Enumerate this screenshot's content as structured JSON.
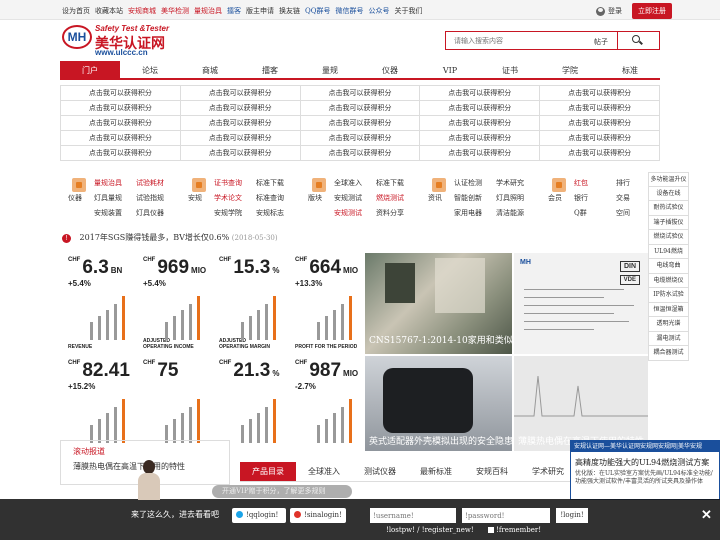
{
  "topbar": {
    "links": [
      {
        "text": "设为首页",
        "color": "normal"
      },
      {
        "text": "收藏本站",
        "color": "normal"
      },
      {
        "text": "安规商城",
        "color": "red"
      },
      {
        "text": "美华检测",
        "color": "red"
      },
      {
        "text": "量规治具",
        "color": "red"
      },
      {
        "text": "擂客",
        "color": "blue"
      },
      {
        "text": "版主申请",
        "color": "normal"
      },
      {
        "text": "换友链",
        "color": "normal"
      },
      {
        "text": "QQ群号",
        "color": "blue"
      },
      {
        "text": "微信群号",
        "color": "blue"
      },
      {
        "text": "公众号",
        "color": "blue"
      },
      {
        "text": "关于我们",
        "color": "normal"
      }
    ],
    "login": "登录",
    "register": "立即注册"
  },
  "logo": {
    "mark": "MH",
    "en": "Safety Test &Tester",
    "cn": "美华认证网",
    "url": "www.ulccc.cn"
  },
  "search": {
    "placeholder": "请输入搜索内容",
    "tag": "帖子"
  },
  "nav": [
    "门户",
    "论坛",
    "商城",
    "擂客",
    "量规",
    "仪器",
    "VIP",
    "证书",
    "学院",
    "标准"
  ],
  "grid": {
    "cell": "点击我可以获得积分",
    "rows": 5,
    "cols": 5
  },
  "categories": [
    {
      "name": "仪器",
      "links": [
        {
          "t": "量规治具",
          "r": true
        },
        {
          "t": "试验耗材",
          "r": true
        },
        {
          "t": "灯具量规",
          "r": false
        },
        {
          "t": "试验指规",
          "r": false
        },
        {
          "t": "安规装置",
          "r": false
        },
        {
          "t": "灯具仪器",
          "r": false
        }
      ]
    },
    {
      "name": "安规",
      "links": [
        {
          "t": "证书查询",
          "r": true
        },
        {
          "t": "标准下载",
          "r": false
        },
        {
          "t": "学术论文",
          "r": true
        },
        {
          "t": "标准查询",
          "r": false
        },
        {
          "t": "安规学院",
          "r": false
        },
        {
          "t": "安规标志",
          "r": false
        }
      ]
    },
    {
      "name": "版块",
      "links": [
        {
          "t": "全球准入",
          "r": false
        },
        {
          "t": "标准下载",
          "r": false
        },
        {
          "t": "安规测试",
          "r": false
        },
        {
          "t": "燃烧测试",
          "r": true
        },
        {
          "t": "安规测试",
          "r": true
        },
        {
          "t": "资料分享",
          "r": false
        }
      ]
    },
    {
      "name": "资讯",
      "links": [
        {
          "t": "认证检测",
          "r": false
        },
        {
          "t": "学术研究",
          "r": false
        },
        {
          "t": "智能创新",
          "r": false
        },
        {
          "t": "灯具照明",
          "r": false
        },
        {
          "t": "家用电器",
          "r": false
        },
        {
          "t": "清洁能源",
          "r": false
        }
      ]
    },
    {
      "name": "会员",
      "links": [
        {
          "t": "红包",
          "r": true
        },
        {
          "t": "排行",
          "r": false
        },
        {
          "t": "银行",
          "r": false
        },
        {
          "t": "交易",
          "r": false
        },
        {
          "t": "Q群",
          "r": false
        },
        {
          "t": "空间",
          "r": false
        }
      ]
    }
  ],
  "side_list": [
    "多功能温升仪",
    "设备在线",
    "耐热试验仪",
    "端子插拔仪",
    "燃烧试验仪",
    "UL94燃烧",
    "电线弯曲",
    "电缆燃烧仪",
    "IP防水试验",
    "恒温恒湿箱",
    "透明光谱",
    "漏电测试",
    "耦合器测试"
  ],
  "news": {
    "text": "2017年SGS赚得钱最多，BV增长仅0.6%",
    "date": "(2018-05-30)"
  },
  "chart_tiles": [
    {
      "value": "6.3",
      "unit": "BN",
      "delta": "+5.4%",
      "caption": "REVENUE"
    },
    {
      "value": "969",
      "unit": "MIO",
      "delta": "+5.4%",
      "caption": "ADJUSTED\nOPERATING INCOME"
    },
    {
      "value": "15.3",
      "unit": "%",
      "delta": "",
      "caption": "ADJUSTED\nOPERATING MARGIN"
    },
    {
      "value": "664",
      "unit": "MIO",
      "delta": "+13.3%",
      "caption": "PROFIT FOR THE PERIOD"
    },
    {
      "value": "82.41",
      "unit": "",
      "delta": "+15.2%",
      "caption": ""
    },
    {
      "value": "75",
      "unit": "",
      "delta": "",
      "caption": ""
    },
    {
      "value": "21.3",
      "unit": "%",
      "delta": "",
      "caption": ""
    },
    {
      "value": "987",
      "unit": "MIO",
      "delta": "-2.7%",
      "caption": ""
    }
  ],
  "tile_prefix": "CHF",
  "photos": [
    {
      "caption": "CNS15767-1:2014-10家用和类似用途插"
    },
    {
      "caption": "英式适配器外壳模拟出现的安全隐患"
    },
    {
      "caption": "薄膜热电偶在高温下使用的特性"
    }
  ],
  "doc": {
    "head": "MH",
    "din": "DIN",
    "vde": "VDE"
  },
  "left_panel": {
    "title": "滚动报道",
    "news": "薄膜热电偶在高温下使用的特性"
  },
  "tabs": [
    "产品目录",
    "全球准入",
    "测试仪器",
    "最新标准",
    "安规百科",
    "学术研究",
    "检测"
  ],
  "popup": {
    "head": "安规认证网—美华认证网安规网安规网|美华安规",
    "title": "高精度功能强大的UL94燃烧测试方案",
    "body": "优化版：在UL实验室方案优先画/UL94标准全功能/功能强大测试软件/丰富灵活的所试夹具及操作体"
  },
  "bottom_bar": {
    "text": "来了这么久，进去看看吧",
    "qq": "!qqlogin!",
    "weibo": "!sinalogin!",
    "user_placeholder": "!username!",
    "pass_placeholder": "!password!",
    "login": "!login!",
    "links": "!lostpw!  / !register_new!",
    "remember": "!fremember!",
    "pill": "开通VIP赠于积分，了解更多规则"
  }
}
